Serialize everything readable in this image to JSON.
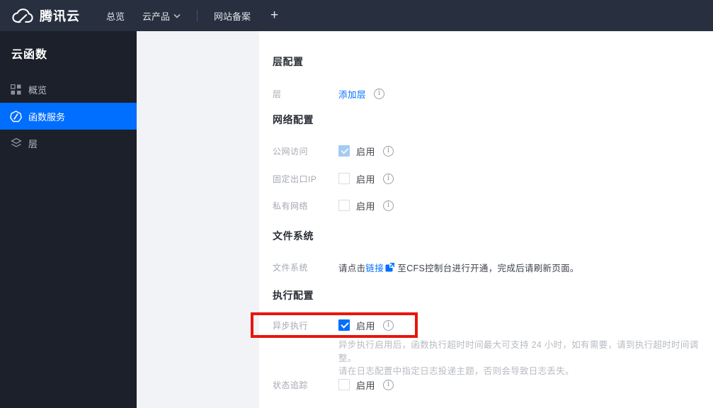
{
  "topbar": {
    "brand": "腾讯云",
    "nav_overview": "总览",
    "nav_products": "云产品",
    "nav_icp": "网站备案",
    "nav_add": "+"
  },
  "sidebar": {
    "title": "云函数",
    "items": [
      {
        "label": "概览",
        "icon": "grid-icon",
        "selected": false
      },
      {
        "label": "函数服务",
        "icon": "function-service-icon",
        "selected": true
      },
      {
        "label": "层",
        "icon": "layers-icon",
        "selected": false
      }
    ]
  },
  "content": {
    "layer_section": {
      "title": "层配置",
      "row_label": "层",
      "add_layer_link": "添加层"
    },
    "network_section": {
      "title": "网络配置",
      "rows": [
        {
          "label": "公网访问",
          "value": "启用",
          "state": "checked-disabled"
        },
        {
          "label": "固定出口IP",
          "value": "启用",
          "state": "unchecked"
        },
        {
          "label": "私有网络",
          "value": "启用",
          "state": "unchecked"
        }
      ]
    },
    "filesystem_section": {
      "title": "文件系统",
      "row_label": "文件系统",
      "text_before_link": "请点击",
      "link": "链接",
      "text_after_link": "至CFS控制台进行开通，完成后请刷新页面。"
    },
    "execution_section": {
      "title": "执行配置",
      "async_row": {
        "label": "异步执行",
        "value": "启用",
        "state": "checked"
      },
      "async_desc_line1": "异步执行启用后，函数执行超时时间最大可支持 24 小时，如有需要，请到执行超时时间调整。",
      "async_desc_line2": "请在日志配置中指定日志投递主题，否则会导致日志丢失。",
      "status_row": {
        "label": "状态追踪",
        "value": "启用",
        "state": "unchecked"
      }
    }
  },
  "colors": {
    "accent_blue": "#006eff",
    "topbar_bg": "#28303f",
    "sidebar_bg": "#1c202a",
    "gutter_bg": "#f2f3f6",
    "annotation_red": "#e8160c",
    "checked_disabled_blue": "#a6cbf2"
  }
}
